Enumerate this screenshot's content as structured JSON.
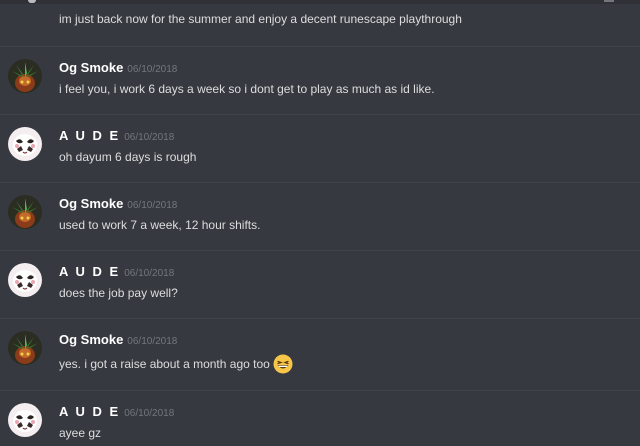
{
  "channel": {
    "first_line": "im just back now for the summer and enjoy a decent runescape playthrough"
  },
  "messages": [
    {
      "author": "Og Smoke",
      "timestamp": "06/10/2018",
      "text": "i feel you, i work 6 days a week so i dont get to play as much as id like.",
      "avatar": "og-smoke-avatar"
    },
    {
      "author": "A U D E",
      "timestamp": "06/10/2018",
      "text": "oh dayum 6 days is rough",
      "avatar": "aude-avatar"
    },
    {
      "author": "Og Smoke",
      "timestamp": "06/10/2018",
      "text": "used to work 7 a week, 12 hour shifts.",
      "avatar": "og-smoke-avatar"
    },
    {
      "author": "A U D E",
      "timestamp": "06/10/2018",
      "text": "does the job pay well?",
      "avatar": "aude-avatar"
    },
    {
      "author": "Og Smoke",
      "timestamp": "06/10/2018",
      "text": "yes. i got a raise about a month ago too",
      "avatar": "og-smoke-avatar",
      "emoji": "grinning-squinting-face-icon"
    },
    {
      "author": "A U D E",
      "timestamp": "06/10/2018",
      "text": "ayee gz",
      "avatar": "aude-avatar"
    }
  ],
  "colors": {
    "background": "#36393f",
    "text": "#dcddde",
    "author": "#ffffff",
    "timestamp": "#72767d",
    "divider": "#3f4248"
  }
}
